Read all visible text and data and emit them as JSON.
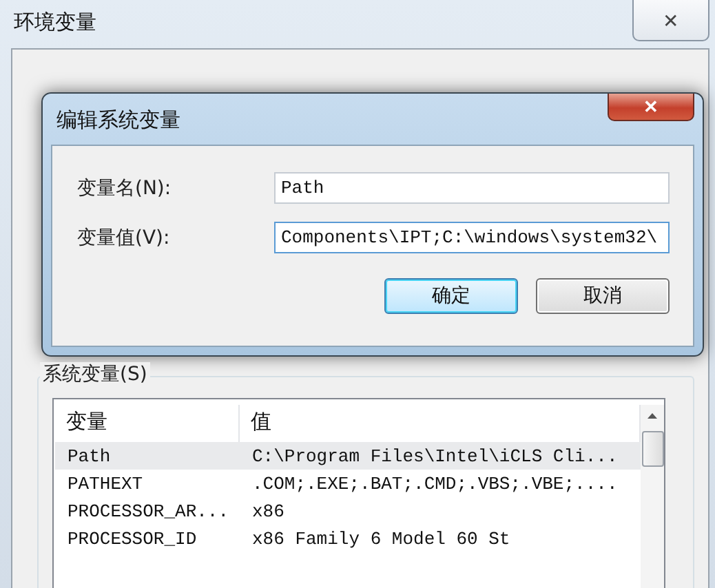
{
  "window": {
    "title": "环境变量",
    "close": "✕"
  },
  "dialog": {
    "title": "编辑系统变量",
    "close": "✕",
    "fields": [
      {
        "label": "变量名(N):",
        "value": "Path",
        "focused": false
      },
      {
        "label": "变量值(V):",
        "value": "Components\\IPT;C:\\windows\\system32\\",
        "focused": true
      }
    ],
    "buttons": [
      {
        "label": "确定",
        "default": true
      },
      {
        "label": "取消",
        "default": false
      }
    ]
  },
  "system_variables": {
    "title": "系统变量(S)",
    "columns": [
      "变量",
      "值"
    ],
    "rows": [
      {
        "name": "Path",
        "value": "C:\\Program Files\\Intel\\iCLS Cli...",
        "selected": true
      },
      {
        "name": "PATHEXT",
        "value": ".COM;.EXE;.BAT;.CMD;.VBS;.VBE;....",
        "selected": false
      },
      {
        "name": "PROCESSOR_AR...",
        "value": "x86",
        "selected": false
      },
      {
        "name": "PROCESSOR_ID",
        "value": "x86 Family 6 Model 60 St",
        "selected": false
      }
    ]
  }
}
